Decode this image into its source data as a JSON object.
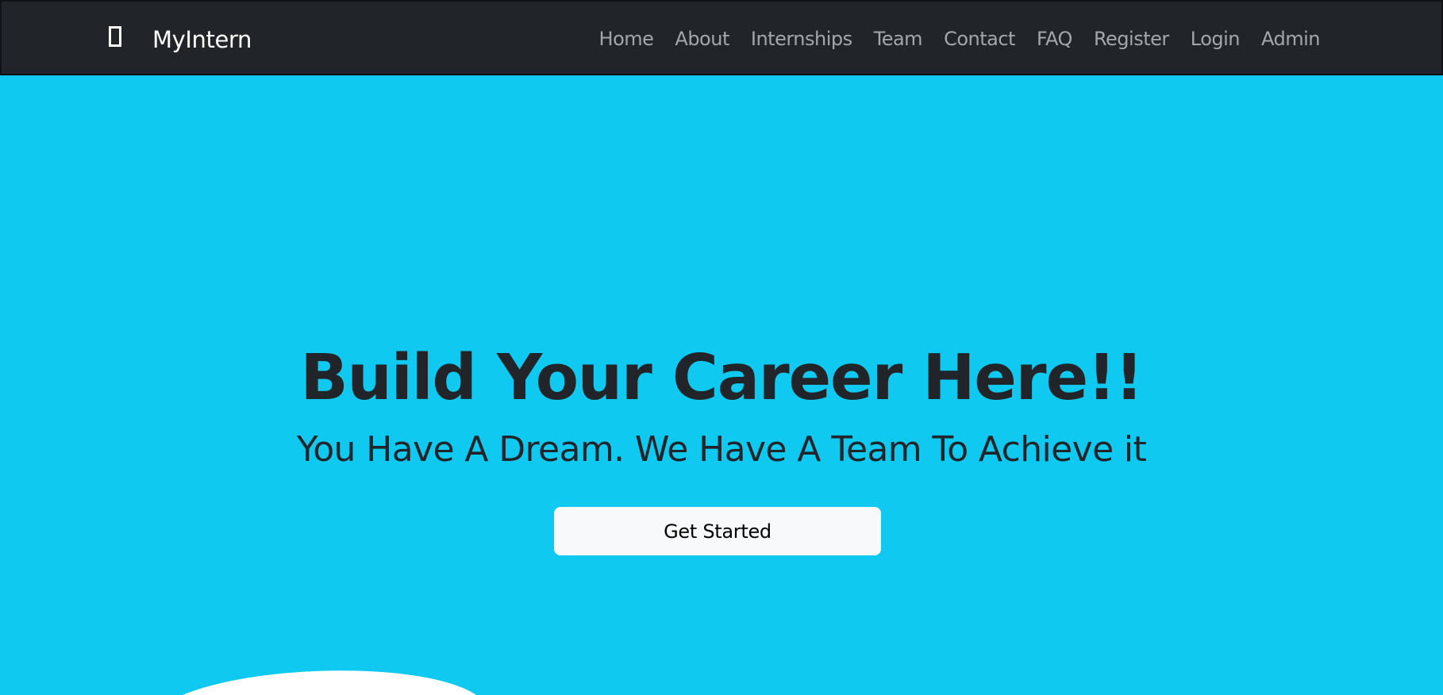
{
  "colors": {
    "navbar_bg": "#212529",
    "brand_text": "#ffffff",
    "nav_link": "#a4a7aa",
    "hero_bg": "#10c9f0",
    "hero_text": "#212529",
    "button_bg": "#f8f9fa",
    "button_text": "#000000",
    "wave_fill": "#ffffff"
  },
  "navbar": {
    "brand": {
      "icon": "rectangle-outline-icon",
      "label": "MyIntern"
    },
    "links": [
      {
        "label": "Home"
      },
      {
        "label": "About"
      },
      {
        "label": "Internships"
      },
      {
        "label": "Team"
      },
      {
        "label": "Contact"
      },
      {
        "label": "FAQ"
      },
      {
        "label": "Register"
      },
      {
        "label": "Login"
      },
      {
        "label": "Admin"
      }
    ]
  },
  "hero": {
    "title": "Build Your Career Here!!",
    "subtitle": "You Have A Dream. We Have A Team To Achieve it",
    "cta_label": "Get Started"
  }
}
